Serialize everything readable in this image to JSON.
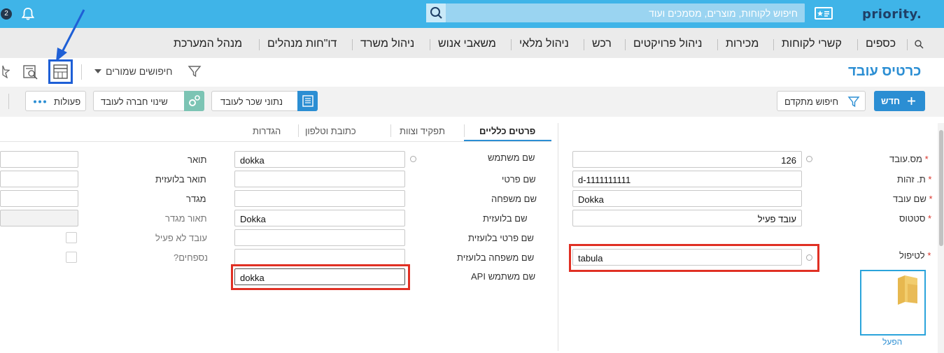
{
  "topbar": {
    "logo": "priority.",
    "search_placeholder": "חיפוש לקוחות, מוצרים, מסמכים ועוד",
    "notifications_count": "2"
  },
  "menu": {
    "items": [
      "כספים",
      "קשרי לקוחות",
      "מכירות",
      "ניהול פרויקטים",
      "רכש",
      "ניהול מלאי",
      "משאבי אנוש",
      "ניהול משרד",
      "דו\"חות מנהלים",
      "מנהל המערכת"
    ]
  },
  "title_row": {
    "page_title": "כרטיס עובד",
    "saved_searches": "חיפושים שמורים"
  },
  "actions": {
    "new": "חדש",
    "advanced_search": "חיפוש מתקדם",
    "salary_data": "נתוני שכר לעובד",
    "change_company": "שינוי חברה לעובד",
    "actions": "פעולות"
  },
  "tabs": [
    "פרטים כלליים",
    "תפקיד וצוות",
    "כתובת וטלפון",
    "הגדרות"
  ],
  "left_form": {
    "employee_no_label": "מס.עובד",
    "employee_no": "126",
    "id_label": "ת. זהות",
    "id_value": "d-1111111111",
    "name_label": "שם עובד",
    "name_value": "Dokka",
    "status_label": "סטטוס",
    "status_value": "עובד פעיל",
    "handling_label": "לטיפול",
    "handling_value": "tabula",
    "folder_label": "הפעל"
  },
  "middle_form": {
    "username_label": "שם משתמש",
    "username_value": "dokka",
    "first_name_label": "שם פרטי",
    "first_name_value": "",
    "last_name_label": "שם משפחה",
    "last_name_value": "",
    "foreign_name_label": "שם בלועזית",
    "foreign_name_value": "Dokka",
    "foreign_first_label": "שם פרטי בלועזית",
    "foreign_first_value": "",
    "foreign_last_label": "שם משפחה בלועזית",
    "foreign_last_value": "",
    "api_user_label": "שם משתמש API",
    "api_user_value": "dokka"
  },
  "right_form": {
    "title_label": "תואר",
    "title_foreign_label": "תואר בלועזית",
    "gender_label": "מגדר",
    "gender_desc_label": "תאור מגדר",
    "inactive_label": "עובד לא פעיל",
    "attachments_label": "נספחים?"
  },
  "colors": {
    "topbar": "#3fb4e8",
    "accent": "#2b8ed3",
    "highlight_red": "#e03024",
    "highlight_blue": "#1e5fd6"
  }
}
